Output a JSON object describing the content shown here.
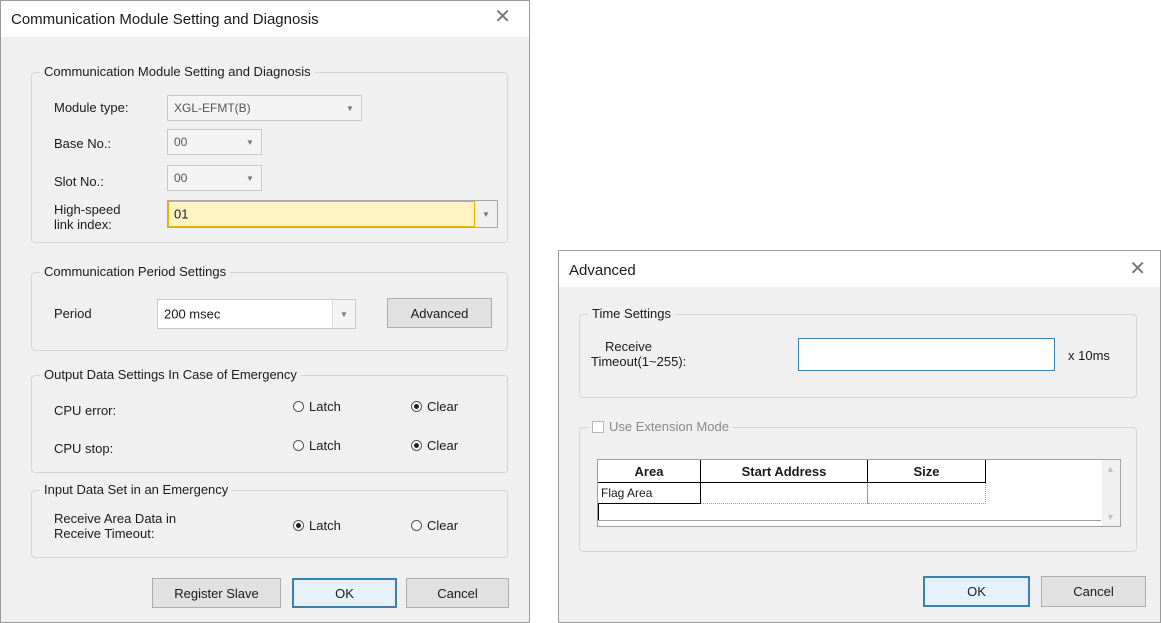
{
  "left_dialog": {
    "title": "Communication Module Setting and Diagnosis",
    "close_glyph": "✕",
    "module_group": {
      "legend": "Communication Module Setting and Diagnosis",
      "module_type_label": "Module type:",
      "module_type_value": "XGL-EFMT(B)",
      "base_no_label": "Base No.:",
      "base_no_value": "00",
      "slot_no_label": "Slot No.:",
      "slot_no_value": "00",
      "link_index_label_line1": "High-speed",
      "link_index_label_line2": "link index:",
      "link_index_value": "01"
    },
    "period_group": {
      "legend": "Communication Period Settings",
      "period_label": "Period",
      "period_value": "200 msec",
      "advanced_label": "Advanced"
    },
    "output_group": {
      "legend": "Output Data Settings In Case of Emergency",
      "cpu_error_label": "CPU error:",
      "cpu_stop_label": "CPU stop:",
      "latch_label": "Latch",
      "clear_label": "Clear",
      "cpu_error_selected": "Clear",
      "cpu_stop_selected": "Clear"
    },
    "input_group": {
      "legend": "Input Data Set in an Emergency",
      "receive_label_line1": "Receive Area Data in",
      "receive_label_line2": "Receive Timeout:",
      "latch_label": "Latch",
      "clear_label": "Clear",
      "selected": "Latch"
    },
    "buttons": {
      "register_slave": "Register Slave",
      "ok": "OK",
      "cancel": "Cancel"
    }
  },
  "right_dialog": {
    "title": "Advanced",
    "close_glyph": "✕",
    "time_group": {
      "legend": "Time Settings",
      "receive_label_line1": "Receive",
      "receive_label_line2": "Timeout(1~255):",
      "receive_value": "",
      "unit": "x 10ms"
    },
    "extension_group": {
      "legend": "Use Extension Mode",
      "checked": false,
      "table": {
        "columns": [
          "Area",
          "Start Address",
          "Size"
        ],
        "rows": [
          [
            "Flag Area",
            "",
            ""
          ]
        ]
      }
    },
    "buttons": {
      "ok": "OK",
      "cancel": "Cancel"
    }
  },
  "colors": {
    "dialog_bg": "#f0f0f0",
    "focus_blue": "#3c7fb1",
    "highlight_yellow": "#fff3c2"
  }
}
